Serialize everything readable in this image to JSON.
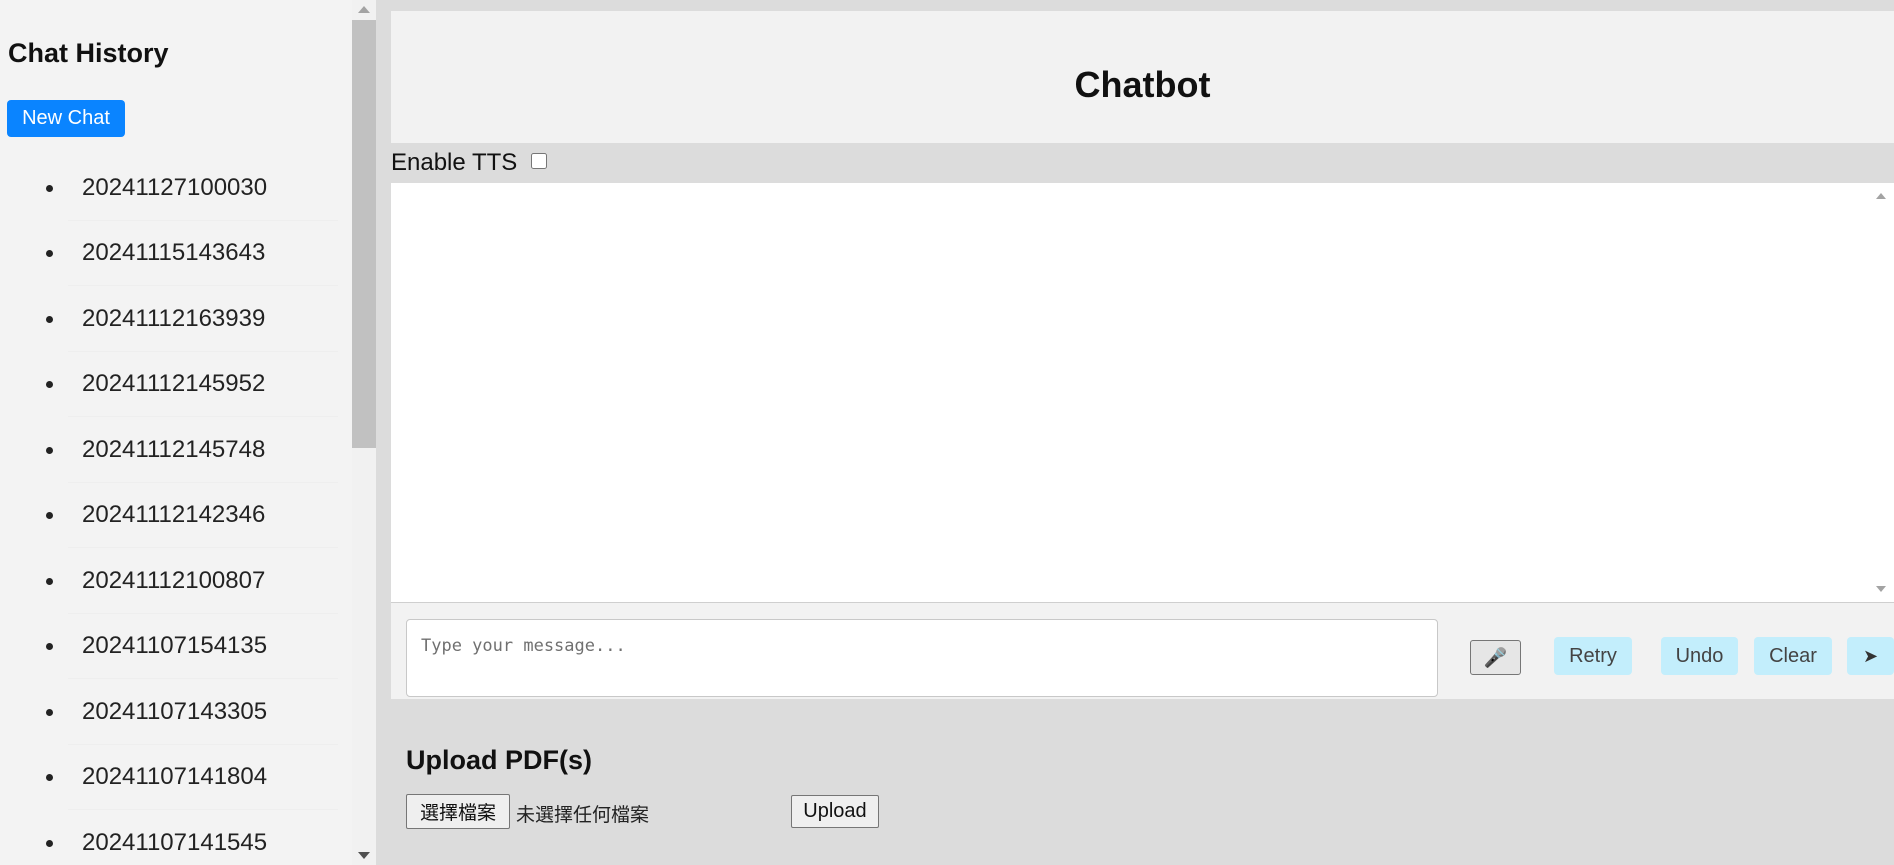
{
  "sidebar": {
    "title": "Chat History",
    "new_chat_label": "New Chat",
    "items": [
      {
        "label": "20241127100030"
      },
      {
        "label": "20241115143643"
      },
      {
        "label": "20241112163939"
      },
      {
        "label": "20241112145952"
      },
      {
        "label": "20241112145748"
      },
      {
        "label": "20241112142346"
      },
      {
        "label": "20241112100807"
      },
      {
        "label": "20241107154135"
      },
      {
        "label": "20241107143305"
      },
      {
        "label": "20241107141804"
      },
      {
        "label": "20241107141545"
      }
    ]
  },
  "chat": {
    "title": "Chatbot",
    "tts_label": "Enable TTS",
    "tts_enabled": false,
    "input_placeholder": "Type your message...",
    "mic_icon": "microphone-icon",
    "buttons": {
      "retry": "Retry",
      "undo": "Undo",
      "clear": "Clear",
      "send": "➤"
    }
  },
  "upload": {
    "title": "Upload PDF(s)",
    "choose_label": "選擇檔案",
    "status_text": "未選擇任何檔案",
    "upload_label": "Upload"
  },
  "colors": {
    "accent": "#0a84ff",
    "action_button_bg": "#c3eefc",
    "sidebar_bg": "#f3f3f3",
    "page_bg": "#dcdcdc"
  }
}
